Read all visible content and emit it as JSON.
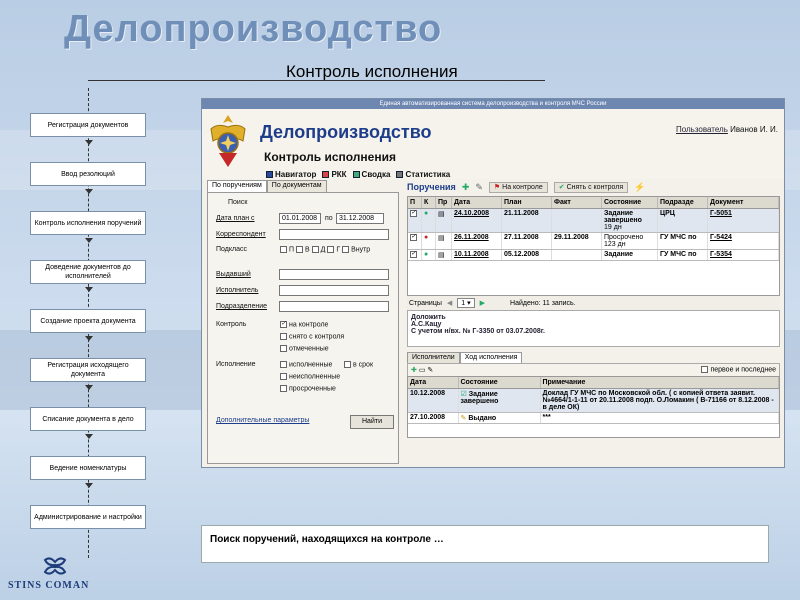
{
  "slide": {
    "title": "Делопроизводство",
    "subtitle": "Контроль исполнения",
    "caption": "Поиск поручений, находящихся на контроле …",
    "logo_text": "STINS COMAN"
  },
  "steps": [
    "Регистрация документов",
    "Ввод резолюций",
    "Контроль исполнения поручений",
    "Доведение документов до исполнителей",
    "Создание проекта документа",
    "Регистрация исходящего документа",
    "Списание документа в дело",
    "Ведение номенклатуры",
    "Администрирование и настройки"
  ],
  "app": {
    "window_title": "Единая автоматизированная система делопроизводства и контроля МЧС России",
    "title": "Делопроизводство",
    "subtitle": "Контроль исполнения",
    "user_link": "Пользователь",
    "user_name": "Иванов И. И.",
    "nav": [
      "Навигатор",
      "РКК",
      "Сводка",
      "Статистика"
    ],
    "tabs": [
      "По поручениям",
      "По документам"
    ],
    "search": {
      "group": "Поиск",
      "date_label": "Дата план с",
      "date_from": "01.01.2008",
      "date_to_label": "по",
      "date_to": "31.12.2008",
      "correspondent": "Корреспондент",
      "subclass": "Подкласс",
      "subclass_opts": [
        "П",
        "В",
        "Д",
        "Г",
        "Внутр"
      ],
      "issuer": "Выдавший",
      "executor": "Исполнитель",
      "division": "Подразделение",
      "control_label": "Контроль",
      "control_opts": [
        "на контроле",
        "снято с контроля",
        "отмеченные"
      ],
      "exec_label": "Исполнение",
      "exec_opts": [
        "исполненные",
        "в срок",
        "неисполненные",
        "просроченные"
      ],
      "more": "Дополнительные параметры",
      "find": "Найти"
    },
    "orders": {
      "title": "Поручения",
      "on_control": "На контроле",
      "remove_control": "Снять с контроля",
      "headers": [
        "П",
        "К",
        "Пр",
        "Дата",
        "План",
        "Факт",
        "Состояние",
        "Подразде",
        "Документ"
      ],
      "rows": [
        {
          "date": "24.10.2008",
          "plan": "21.11.2008",
          "fact": "",
          "state": "Задание завершено",
          "state2": "19 дн",
          "dept": "ЦРЦ",
          "doc": "Г-5051"
        },
        {
          "date": "26.11.2008",
          "plan": "27.11.2008",
          "fact": "29.11.2008",
          "state": "Просрочено",
          "state2": "123 дн",
          "dept": "ГУ МЧС по",
          "doc": "Г-5424"
        },
        {
          "date": "10.11.2008",
          "plan": "05.12.2008",
          "fact": "",
          "state": "Задание",
          "state2": "",
          "dept": "ГУ МЧС по",
          "doc": "Г-5354"
        }
      ],
      "pages_label": "Страницы",
      "page": "1",
      "found": "Найдено: 11 запись."
    },
    "note": {
      "line1": "Доложить",
      "line2": "А.С.Кацу",
      "line3": "С учетом н/вх. № Г-3350 от 03.07.2008г."
    },
    "history": {
      "tabs": [
        "Исполнители",
        "Ход исполнения"
      ],
      "first_last": "первое и последнее",
      "headers": [
        "Дата",
        "Состояние",
        "Примечание"
      ],
      "rows": [
        {
          "date": "10.12.2008",
          "state": "Задание завершено",
          "note": "Доклад ГУ МЧС по Московской обл. ( с копией ответа заявит. №4664/1-1-11 от 20.11.2008 подп. О.Ломакин ( В-71166 от 8.12.2008 - в деле ОК)"
        },
        {
          "date": "27.10.2008",
          "state": "Выдано",
          "note": "***"
        }
      ]
    }
  }
}
